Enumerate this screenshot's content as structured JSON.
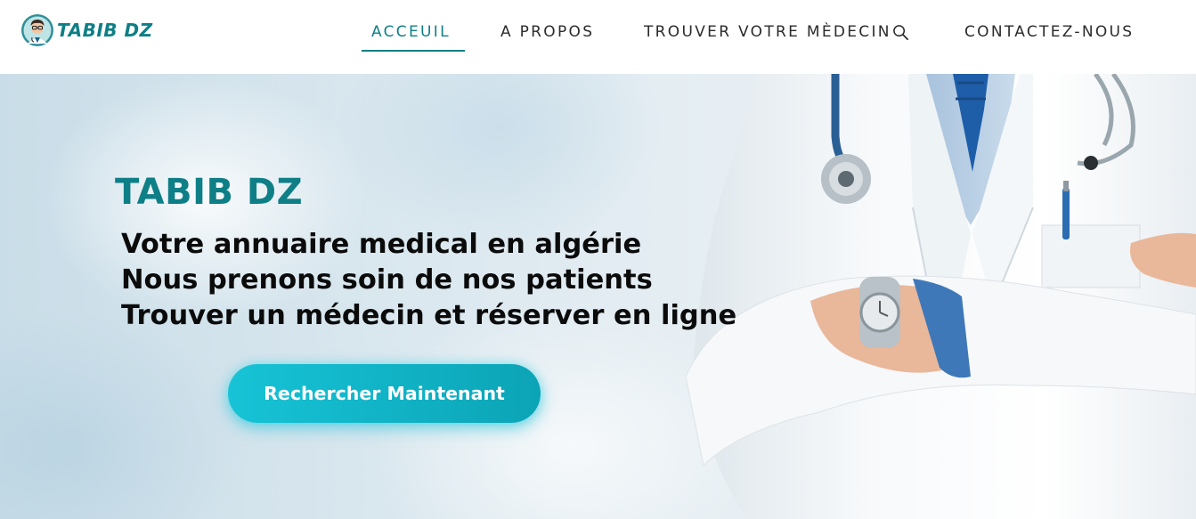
{
  "header": {
    "logo_text": "TABIB DZ",
    "logo_icon": "doctor-avatar-icon",
    "nav": [
      {
        "label": "ACCEUIL",
        "active": true
      },
      {
        "label": "A PROPOS",
        "active": false
      },
      {
        "label": "TROUVER VOTRE MÈDECIN",
        "active": false,
        "icon": "search-icon"
      },
      {
        "label": "CONTACTEZ-NOUS",
        "active": false
      }
    ]
  },
  "hero": {
    "title": "TABIB DZ",
    "lines": [
      "Votre annuaire medical en algérie",
      "Nous prenons soin de nos patients",
      "Trouver un médecin et réserver en ligne"
    ],
    "cta_label": "Rechercher Maintenant",
    "image": "doctor-with-stethoscope"
  },
  "colors": {
    "brand": "#0e7f86",
    "cta_start": "#17c3d6",
    "cta_end": "#0ba4b6",
    "text_dark": "#0b0b0b",
    "nav_text": "#2b2b2b"
  }
}
